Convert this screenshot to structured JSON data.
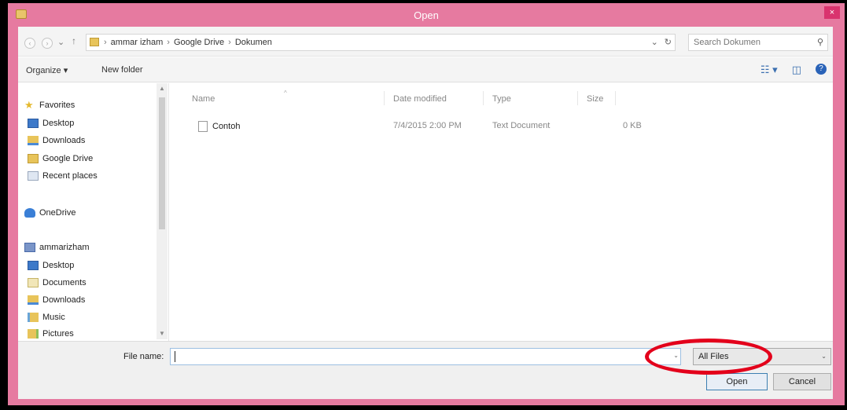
{
  "window": {
    "title": "Open",
    "close_glyph": "×"
  },
  "nav": {
    "back_glyph": "‹",
    "forward_glyph": "›",
    "recent_glyph": "⌄",
    "up_glyph": "↑",
    "breadcrumbs": [
      "ammar izham",
      "Google Drive",
      "Dokumen"
    ],
    "breadcrumb_separator": "›",
    "dropdown_glyph": "⌄",
    "refresh_glyph": "↻"
  },
  "search": {
    "placeholder": "Search Dokumen",
    "icon": "search-icon",
    "icon_glyph": "⚲"
  },
  "toolbar": {
    "organize_label": "Organize ▾",
    "new_folder_label": "New folder",
    "view_glyph": "☷ ▾",
    "preview_glyph": "◫",
    "help_glyph": "?"
  },
  "sidebar": {
    "scroll_up": "▲",
    "scroll_down": "▼",
    "groups": [
      {
        "label": "Favorites",
        "icon": "star-icon",
        "items": [
          {
            "label": "Desktop",
            "icon": "desktop-icon"
          },
          {
            "label": "Downloads",
            "icon": "downloads-icon"
          },
          {
            "label": "Google Drive",
            "icon": "folder-icon"
          },
          {
            "label": "Recent places",
            "icon": "recent-places-icon"
          }
        ]
      },
      {
        "label": "OneDrive",
        "icon": "onedrive-icon",
        "items": []
      },
      {
        "label": "ammarizham",
        "icon": "computer-icon",
        "items": [
          {
            "label": "Desktop",
            "icon": "desktop-icon"
          },
          {
            "label": "Documents",
            "icon": "documents-icon"
          },
          {
            "label": "Downloads",
            "icon": "downloads-icon"
          },
          {
            "label": "Music",
            "icon": "music-icon"
          },
          {
            "label": "Pictures",
            "icon": "pictures-icon"
          }
        ]
      }
    ]
  },
  "filelist": {
    "sort_glyph": "^",
    "columns": [
      "Name",
      "Date modified",
      "Type",
      "Size"
    ],
    "rows": [
      {
        "name": "Contoh",
        "date_modified": "7/4/2015 2:00 PM",
        "type": "Text Document",
        "size": "0 KB",
        "icon": "text-file-icon"
      }
    ]
  },
  "footer": {
    "file_name_label": "File name:",
    "file_name_value": "",
    "dropdown_glyph": "⌄",
    "filter_value": "All Files",
    "open_label": "Open",
    "cancel_label": "Cancel"
  },
  "colors": {
    "titlebar": "#e67aa0",
    "annotation": "#e3001b"
  }
}
